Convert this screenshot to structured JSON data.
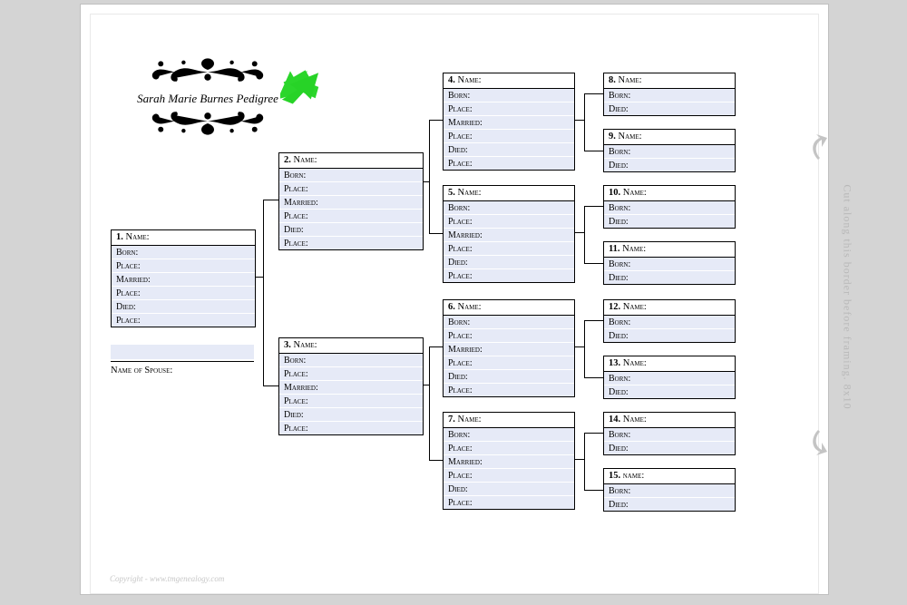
{
  "title": "Sarah Marie Burnes Pedigree",
  "spouse_label": "Name of Spouse:",
  "side_text": "Cut along this border before framing. 8x10",
  "copyright": "Copyright - www.tmgenealogy.com",
  "field_labels": {
    "born": "Born:",
    "place": "Place:",
    "married": "Married:",
    "place2": "Place:",
    "died": "Died:",
    "place3": "Place:"
  },
  "short_labels": {
    "born": "Born:",
    "died": "Died:"
  },
  "boxes": [
    {
      "id": 1,
      "num": "1.",
      "lbl": "Name:"
    },
    {
      "id": 2,
      "num": "2.",
      "lbl": "Name:"
    },
    {
      "id": 3,
      "num": "3.",
      "lbl": "Name:"
    },
    {
      "id": 4,
      "num": "4.",
      "lbl": "Name:"
    },
    {
      "id": 5,
      "num": "5.",
      "lbl": "Name:"
    },
    {
      "id": 6,
      "num": "6.",
      "lbl": "Name:"
    },
    {
      "id": 7,
      "num": "7.",
      "lbl": "Name:"
    },
    {
      "id": 8,
      "num": "8.",
      "lbl": "Name:"
    },
    {
      "id": 9,
      "num": "9.",
      "lbl": "Name:"
    },
    {
      "id": 10,
      "num": "10.",
      "lbl": "Name:"
    },
    {
      "id": 11,
      "num": "11.",
      "lbl": "Name:"
    },
    {
      "id": 12,
      "num": "12.",
      "lbl": "Name:"
    },
    {
      "id": 13,
      "num": "13.",
      "lbl": "Name:"
    },
    {
      "id": 14,
      "num": "14.",
      "lbl": "Name:"
    },
    {
      "id": 15,
      "num": "15.",
      "lbl": "name:"
    }
  ]
}
